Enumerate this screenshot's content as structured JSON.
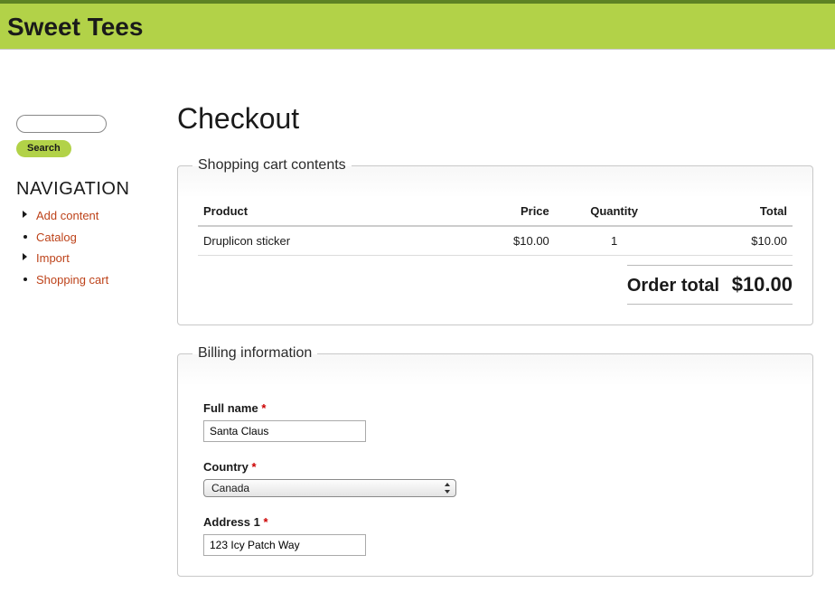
{
  "site_name": "Sweet Tees",
  "search": {
    "button": "Search"
  },
  "nav": {
    "title": "NAVIGATION",
    "items": [
      {
        "label": "Add content",
        "type": "collapsed"
      },
      {
        "label": "Catalog",
        "type": "leaf"
      },
      {
        "label": "Import",
        "type": "collapsed"
      },
      {
        "label": "Shopping cart",
        "type": "leaf"
      }
    ]
  },
  "page_title": "Checkout",
  "cart": {
    "legend": "Shopping cart contents",
    "headers": {
      "product": "Product",
      "price": "Price",
      "qty": "Quantity",
      "total": "Total"
    },
    "rows": [
      {
        "product": "Druplicon sticker",
        "price": "$10.00",
        "qty": "1",
        "total": "$10.00"
      }
    ],
    "order_total_label": "Order total",
    "order_total_value": "$10.00"
  },
  "billing": {
    "legend": "Billing information",
    "full_name_label": "Full name",
    "full_name_value": "Santa Claus",
    "country_label": "Country",
    "country_value": "Canada",
    "address1_label": "Address 1",
    "address1_value": "123 Icy Patch Way",
    "required_marker": "*"
  }
}
